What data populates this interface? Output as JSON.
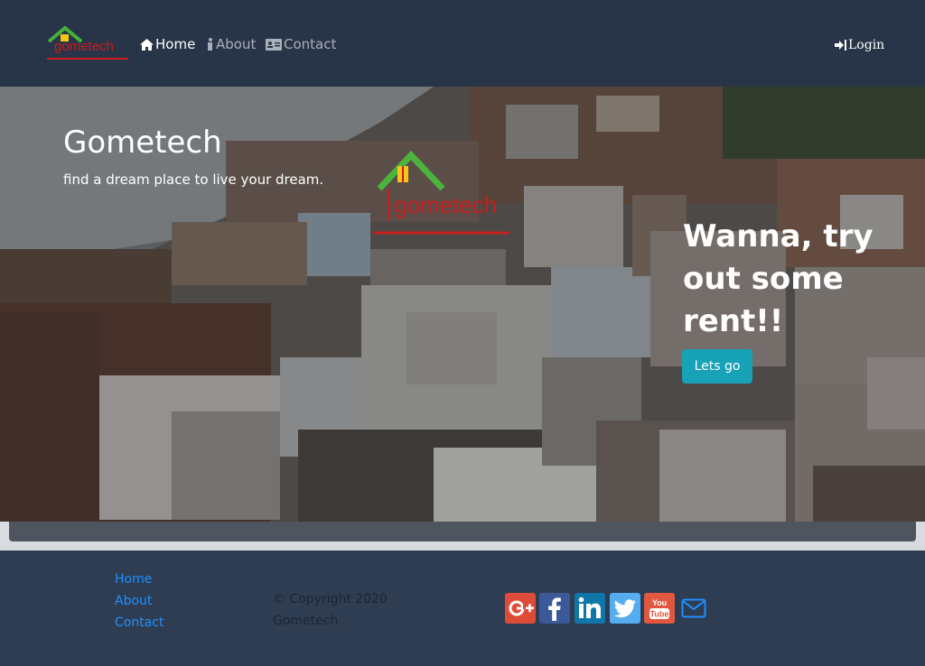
{
  "nav": {
    "brand_text": "gometech",
    "links": [
      {
        "label": "Home",
        "icon": "home-icon",
        "active": true
      },
      {
        "label": "About",
        "icon": "info-icon",
        "active": false
      },
      {
        "label": "Contact",
        "icon": "contact-card-icon",
        "active": false
      }
    ],
    "login_label": "Login",
    "login_icon": "sign-in-icon"
  },
  "hero": {
    "title": "Gometech",
    "subtitle": "find a dream place to live your dream.",
    "logo_text": "gometech",
    "cta_heading": "Wanna, try out some rent!!",
    "cta_button": "Lets go"
  },
  "footer": {
    "links": [
      "Home",
      "About",
      "Contact"
    ],
    "copyright": "© Copyright 2020 Gometech",
    "social": [
      "google-plus-icon",
      "facebook-icon",
      "linkedin-icon",
      "twitter-icon",
      "youtube-icon",
      "mail-icon"
    ]
  },
  "colors": {
    "navbar_bg": "#283447",
    "footer_bg": "#2f3d52",
    "button_accent": "#17a2b8",
    "footer_link": "#1e90ff"
  }
}
